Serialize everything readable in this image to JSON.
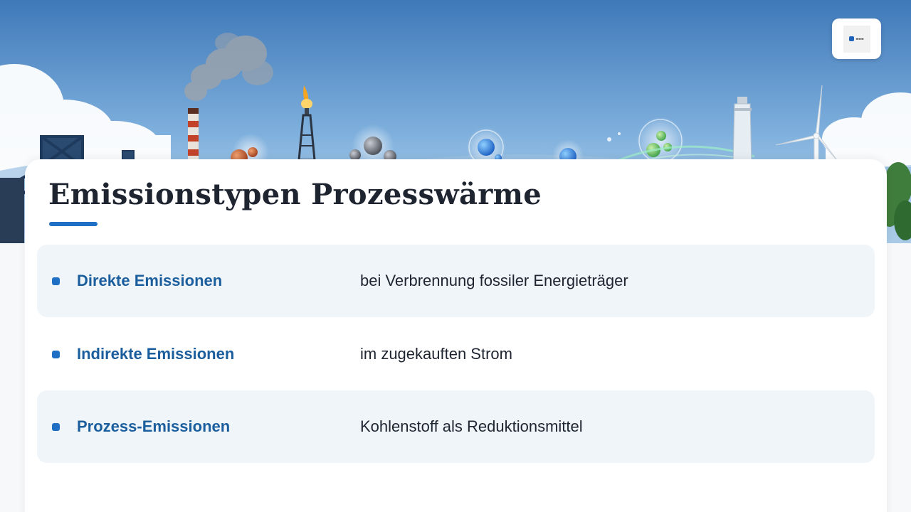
{
  "slide": {
    "title": "Emissionstypen Prozesswärme"
  },
  "emission_types": [
    {
      "label": "Direkte Emissionen",
      "description": "bei Verbrennung fossiler Energieträger"
    },
    {
      "label": "Indirekte Emissionen",
      "description": "im zugekauften Strom"
    },
    {
      "label": "Prozess-Emissionen",
      "description": "Kohlenstoff als Reduktionsmittel"
    }
  ],
  "colors": {
    "accent": "#1f6fc4",
    "label_text": "#1b5e9e",
    "title_text": "#1f2530",
    "row_shade": "#f0f5fa",
    "sky_top": "#3f79b9",
    "sky_bottom": "#bcd8ef"
  },
  "icons": {
    "logo": "company-logo",
    "bullet": "square-bullet"
  }
}
